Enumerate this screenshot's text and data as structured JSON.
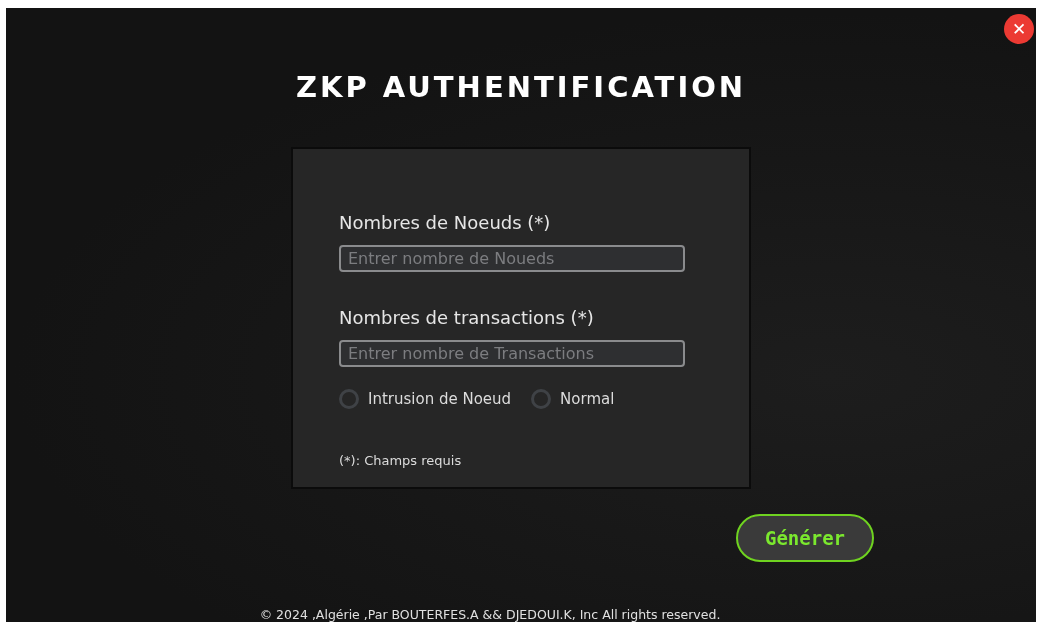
{
  "close_button": {
    "label": "✕"
  },
  "title": "ZKP AUTHENTIFICATION",
  "form": {
    "fields": [
      {
        "label": "Nombres de Noeuds (*)",
        "placeholder": "Entrer nombre de Noueds"
      },
      {
        "label": "Nombres de transactions (*)",
        "placeholder": "Entrer nombre de Transactions"
      }
    ],
    "options": [
      {
        "label": "Intrusion de Noeud",
        "selected": false
      },
      {
        "label": "Normal",
        "selected": false
      }
    ],
    "note": "(*): Champs requis"
  },
  "generate_button": {
    "label": "Générer"
  },
  "footer": "© 2024 ,Algérie ,Par BOUTERFES.A && DJEDOUI.K, Inc All rights reserved."
}
